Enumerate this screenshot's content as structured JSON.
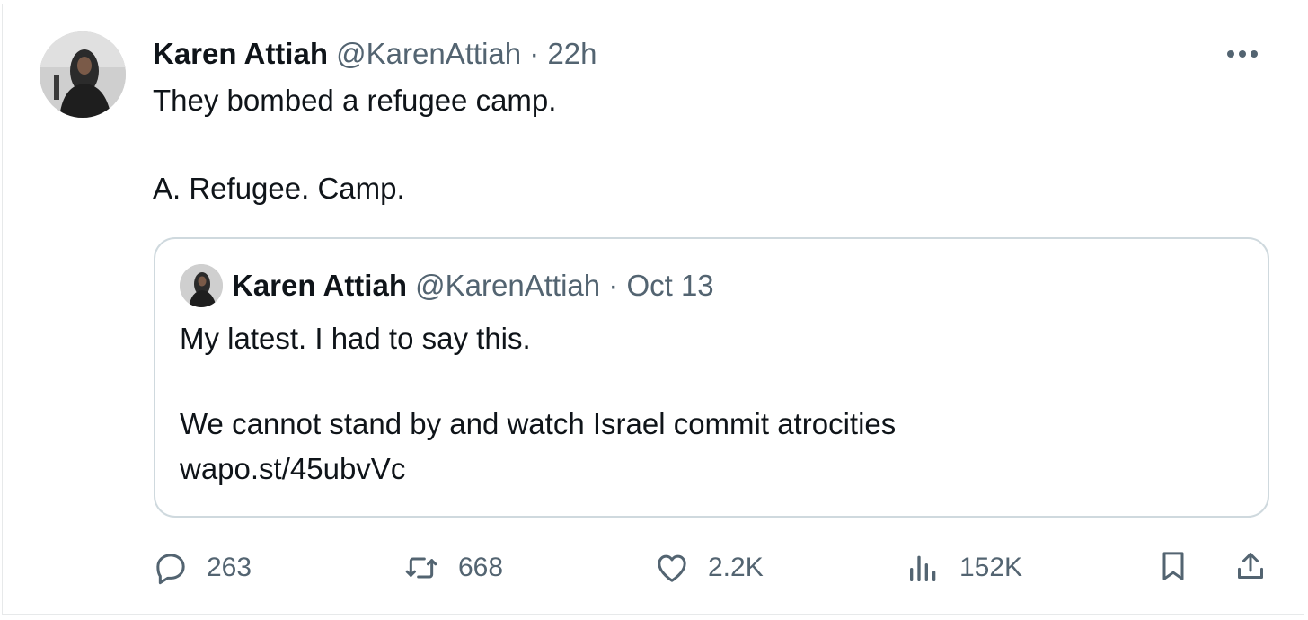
{
  "tweet": {
    "author_name": "Karen Attiah",
    "author_handle": "@KarenAttiah",
    "separator": "·",
    "time": "22h",
    "text_line1": "They bombed a refugee camp.",
    "text_line2": "A. Refugee. Camp."
  },
  "quoted_tweet": {
    "author_name": "Karen Attiah",
    "author_handle": "@KarenAttiah",
    "separator": "·",
    "date": "Oct 13",
    "text_line1": "My latest. I had to say this.",
    "text_line2": "We cannot stand by and watch Israel commit atrocities",
    "link": "wapo.st/45ubvVc"
  },
  "actions": {
    "replies": "263",
    "reposts": "668",
    "likes": "2.2K",
    "views": "152K"
  },
  "icons": {
    "more": "more-dots-icon",
    "reply": "reply-bubble-icon",
    "repost": "repost-arrows-icon",
    "like": "heart-icon",
    "views": "views-bars-icon",
    "bookmark": "bookmark-icon",
    "share": "share-upload-icon"
  },
  "colors": {
    "text": "#0f1419",
    "secondary": "#536471",
    "border": "#cfd9de"
  }
}
